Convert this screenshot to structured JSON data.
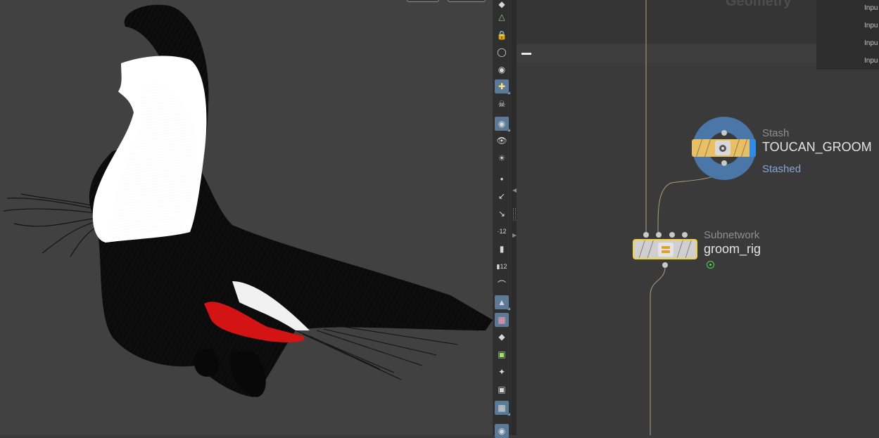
{
  "network": {
    "context_title": "Geometry",
    "inputs": [
      "Inpu",
      "Inpu",
      "Inpu",
      "Inpu"
    ],
    "nodes": [
      {
        "type": "Stash",
        "name": "TOUCAN_GROOM",
        "status": "Stashed",
        "color": "#e8bf62",
        "flag_color": "#2f8ae8"
      },
      {
        "type": "Subnetwork",
        "name": "groom_rig",
        "color": "#cfcfcf",
        "selected_color": "#f2d43b"
      }
    ]
  },
  "toolbar": {
    "tools": [
      "select-icon",
      "geometry-icon",
      "lock-icon",
      "ghost-icon",
      "shading-icon",
      "snap-icon",
      "skeleton-icon",
      "camera-icon",
      "visibility-icon",
      "light-icon",
      "point-icon",
      "brush-icon",
      "picker-icon",
      "point-number-icon",
      "paint-icon",
      "primitive-number-icon",
      "corner-icon",
      "wireframe-icon",
      "texture-icon",
      "layer-icon",
      "uv-icon",
      "transform-icon",
      "background-icon",
      "image-icon",
      "display-options-icon"
    ]
  },
  "colors": {
    "viewport_bg": "#414141",
    "feather_red": "#d41414",
    "node_selected": "#f2d43b",
    "stash_ring": "#4a76a8",
    "stashed_text": "#84a7d6"
  }
}
